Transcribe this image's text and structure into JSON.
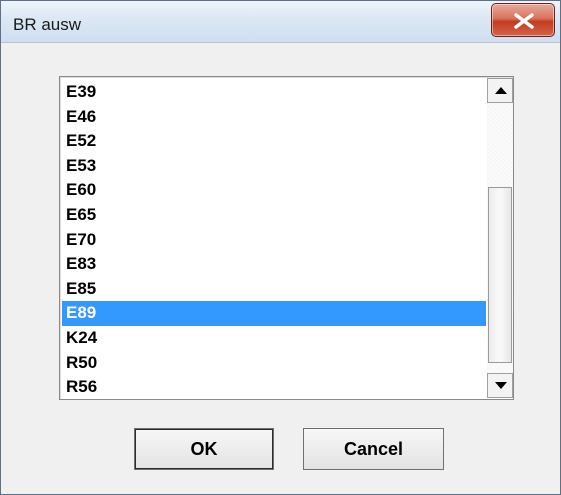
{
  "window": {
    "title": "BR ausw"
  },
  "listbox": {
    "items": [
      "E39",
      "E46",
      "E52",
      "E53",
      "E60",
      "E65",
      "E70",
      "E83",
      "E85",
      "E89",
      "K24",
      "R50",
      "R56"
    ],
    "selected": "E89"
  },
  "buttons": {
    "ok_label": "OK",
    "cancel_label": "Cancel"
  },
  "colors": {
    "selection": "#3399ff",
    "close_button": "#c23d22",
    "dialog_bg": "#f0f0f0"
  }
}
